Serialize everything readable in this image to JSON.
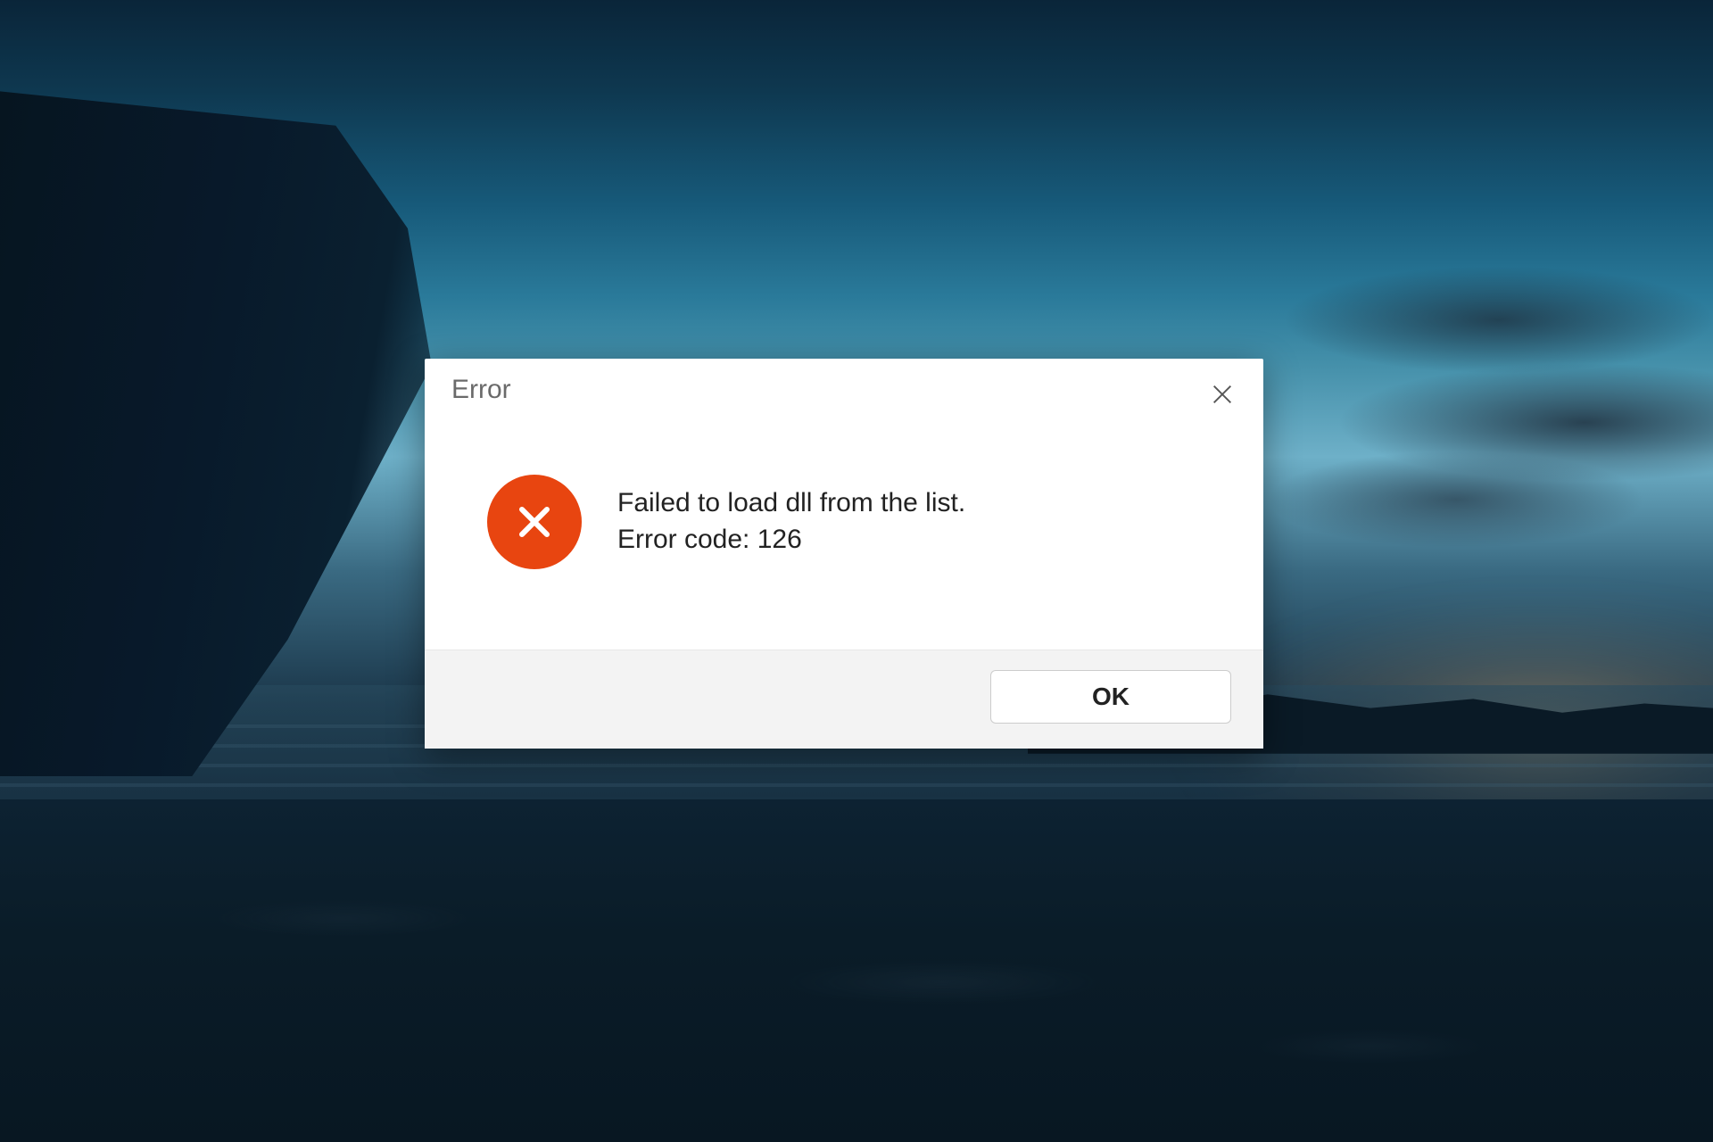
{
  "dialog": {
    "title": "Error",
    "message_line1": "Failed to load dll from the list.",
    "message_line2": "Error code: 126",
    "ok_label": "OK",
    "error_icon_color": "#e84510"
  }
}
